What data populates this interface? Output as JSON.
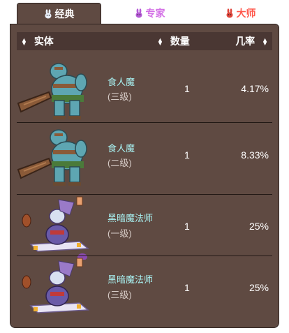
{
  "tabs": [
    {
      "label": "经典",
      "icon": "rabbit-icon",
      "color": "#ffffff",
      "active": true
    },
    {
      "label": "专家",
      "icon": "rabbit-icon",
      "color": "#d36fe6",
      "active": false
    },
    {
      "label": "大师",
      "icon": "rabbit-icon",
      "color": "#ff5a4e",
      "active": false
    }
  ],
  "table": {
    "headers": {
      "entity": "实体",
      "quantity": "数量",
      "rate": "几率"
    },
    "rows": [
      {
        "name": "食人魔",
        "tier": "(三级)",
        "quantity": "1",
        "rate": "4.17%",
        "sprite": "ogre-icon"
      },
      {
        "name": "食人魔",
        "tier": "(二级)",
        "quantity": "1",
        "rate": "8.33%",
        "sprite": "ogre-icon"
      },
      {
        "name": "黑暗魔法师",
        "tier": "(一级)",
        "quantity": "1",
        "rate": "25%",
        "sprite": "dark-mage-icon"
      },
      {
        "name": "黑暗魔法师",
        "tier": "(三级)",
        "quantity": "1",
        "rate": "25%",
        "sprite": "dark-mage-icon"
      }
    ]
  },
  "colors": {
    "panel": "#5f4a42",
    "header": "#4a3733",
    "name_text": "#a9f4f4"
  }
}
